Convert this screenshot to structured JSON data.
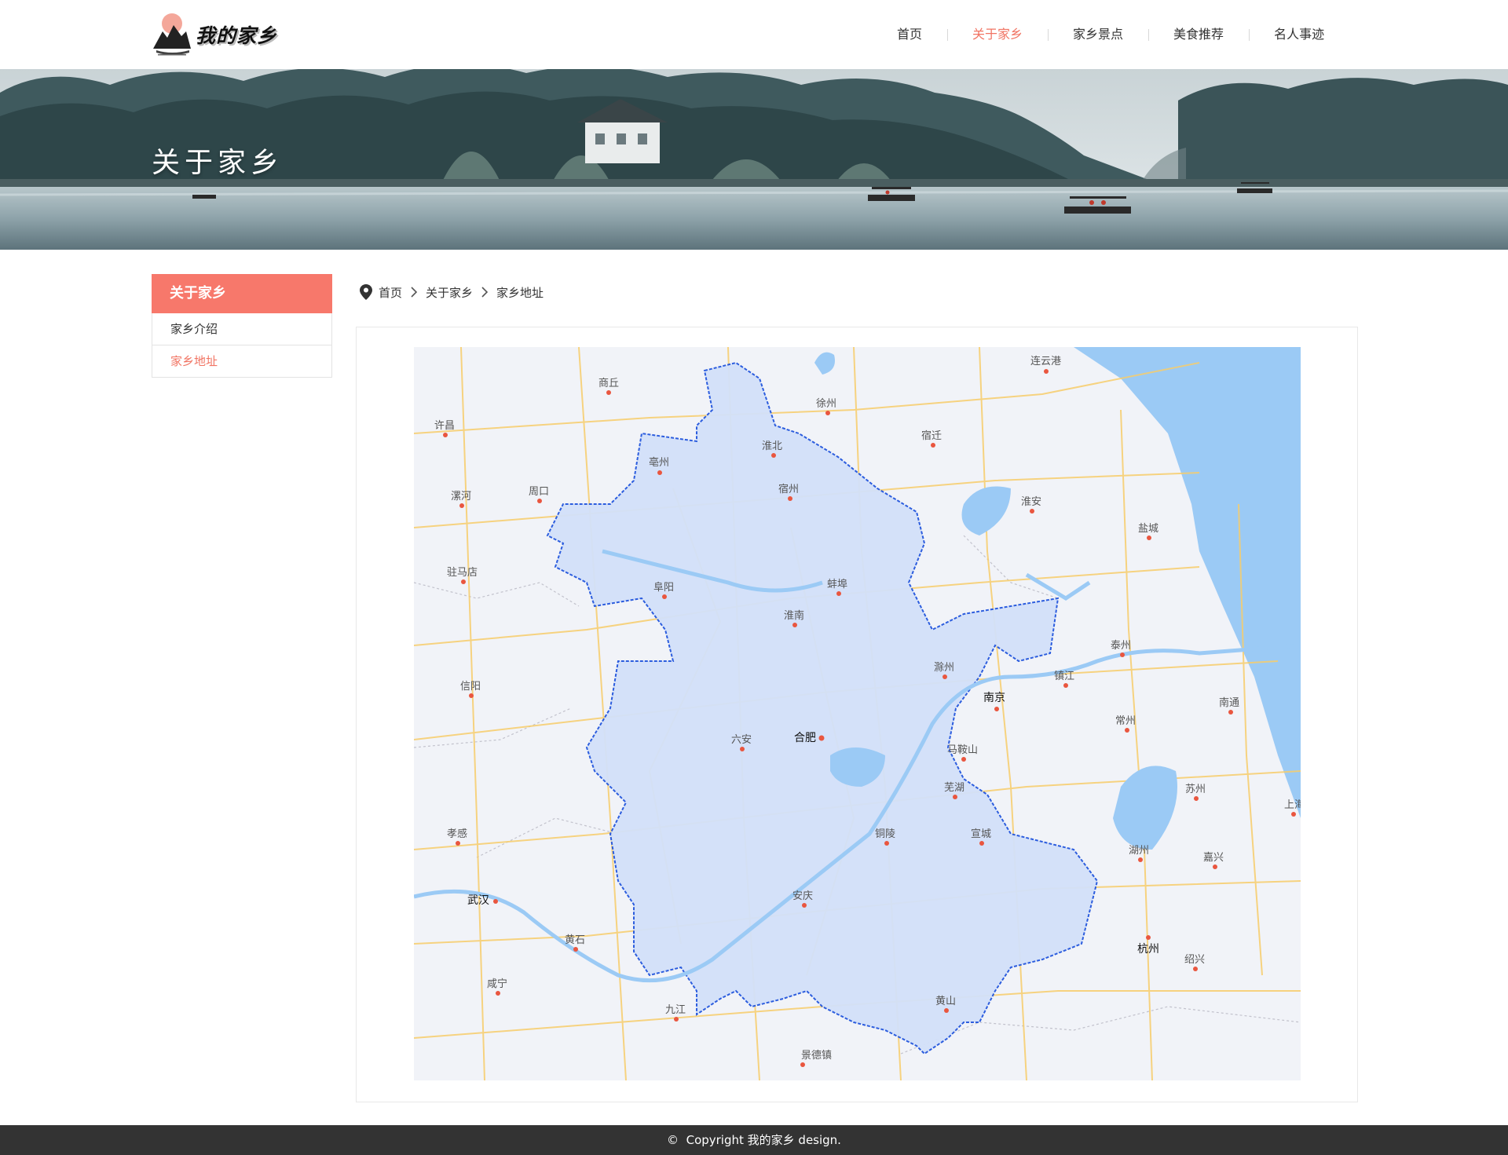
{
  "header": {
    "logo_text": "我的家乡",
    "nav": [
      {
        "label": "首页"
      },
      {
        "label": "关于家乡"
      },
      {
        "label": "家乡景点"
      },
      {
        "label": "美食推荐"
      },
      {
        "label": "名人事迹"
      }
    ],
    "active_nav": 1
  },
  "banner": {
    "title": "关于家乡"
  },
  "sidebar": {
    "heading": "关于家乡",
    "items": [
      {
        "label": "家乡介绍"
      },
      {
        "label": "家乡地址"
      }
    ],
    "active_item": 1
  },
  "breadcrumb": {
    "items": [
      {
        "label": "首页"
      },
      {
        "label": "关于家乡"
      },
      {
        "label": "家乡地址"
      }
    ]
  },
  "map": {
    "cities": [
      {
        "name": "连云港"
      },
      {
        "name": "商丘"
      },
      {
        "name": "徐州"
      },
      {
        "name": "许昌"
      },
      {
        "name": "淮北"
      },
      {
        "name": "宿迁"
      },
      {
        "name": "亳州"
      },
      {
        "name": "宿州"
      },
      {
        "name": "漯河"
      },
      {
        "name": "周口"
      },
      {
        "name": "淮安"
      },
      {
        "name": "盐城"
      },
      {
        "name": "驻马店"
      },
      {
        "name": "阜阳"
      },
      {
        "name": "蚌埠"
      },
      {
        "name": "淮南"
      },
      {
        "name": "泰州"
      },
      {
        "name": "滁州"
      },
      {
        "name": "镇江"
      },
      {
        "name": "信阳"
      },
      {
        "name": "南京"
      },
      {
        "name": "南通"
      },
      {
        "name": "常州"
      },
      {
        "name": "六安"
      },
      {
        "name": "合肥"
      },
      {
        "name": "马鞍山"
      },
      {
        "name": "芜湖"
      },
      {
        "name": "苏州"
      },
      {
        "name": "上海"
      },
      {
        "name": "孝感"
      },
      {
        "name": "铜陵"
      },
      {
        "name": "宣城"
      },
      {
        "name": "湖州"
      },
      {
        "name": "嘉兴"
      },
      {
        "name": "武汉"
      },
      {
        "name": "安庆"
      },
      {
        "name": "黄石"
      },
      {
        "name": "杭州"
      },
      {
        "name": "绍兴"
      },
      {
        "name": "咸宁"
      },
      {
        "name": "九江"
      },
      {
        "name": "黄山"
      },
      {
        "name": "景德镇"
      }
    ]
  },
  "footer": {
    "copyright_symbol": "©",
    "text": "Copyright 我的家乡 design."
  },
  "colors": {
    "accent": "#f7786b",
    "nav_active": "#f17463",
    "footer_bg": "#333333",
    "map_region_fill": "#d3e1fa",
    "map_region_border": "#2255dd",
    "water": "#9bcaf5"
  }
}
